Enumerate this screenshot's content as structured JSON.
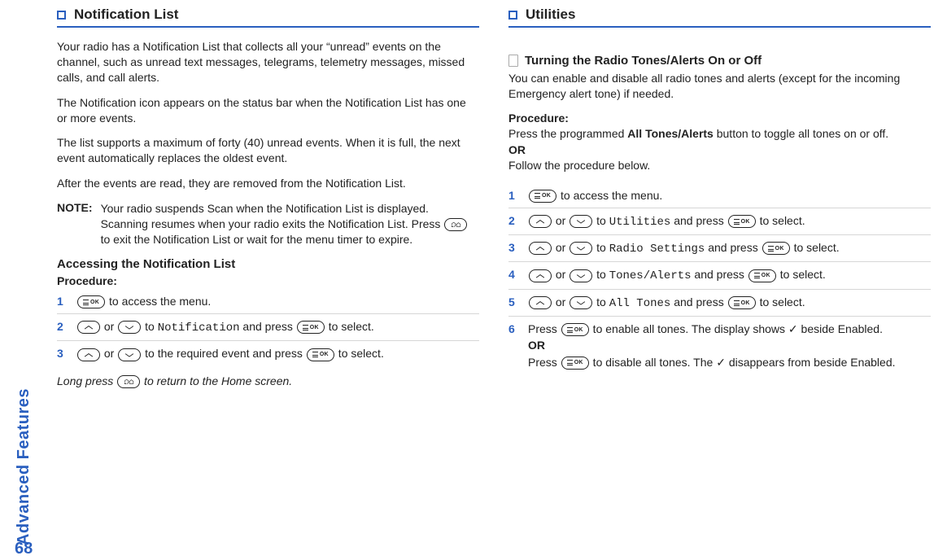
{
  "side_tab": "Advanced Features",
  "page_number": "68",
  "left": {
    "section_title": "Notification List",
    "p1": "Your radio has a Notification List that collects all your “unread” events on the channel, such as unread text messages, telegrams, telemetry messages, missed calls, and call alerts.",
    "p2": "The Notification icon appears on the status bar when the Notification List has one or more events.",
    "p3": " The list supports a maximum of forty (40) unread events. When it is full, the next event automatically replaces the oldest event.",
    "p4": "After the events are read, they are removed from the Notification List.",
    "note_label": "NOTE:",
    "note_body_a": "Your radio suspends Scan when the Notification List is displayed. Scanning resumes when your radio exits the Notification List. Press ",
    "note_body_b": " to exit the Notification List or wait for the menu timer to expire.",
    "sub_heading": "Accessing the Notification List",
    "procedure_label": "Procedure:",
    "steps": {
      "s1_num": "1",
      "s1_b": " to access the menu.",
      "s2_num": "2",
      "s2_or": " or ",
      "s2_to": " to ",
      "s2_target": "Notification",
      "s2_press": " and press ",
      "s2_end": " to select.",
      "s3_num": "3",
      "s3_or": " or ",
      "s3_mid": " to the required event and press ",
      "s3_end": " to select."
    },
    "footer_a": "Long press ",
    "footer_b": " to return to the Home screen."
  },
  "right": {
    "section_title": "Utilities",
    "sub_heading": "Turning the Radio Tones/Alerts On or Off",
    "p1": "You can enable and disable all radio tones and alerts (except for the incoming Emergency alert tone) if needed.",
    "procedure_label": "Procedure:",
    "proc_line_a": "Press the programmed ",
    "proc_bold": "All Tones/Alerts",
    "proc_line_b": " button to toggle all tones on or off.",
    "or_label": "OR",
    "proc_follow": "Follow the procedure below.",
    "steps": {
      "s1_num": "1",
      "s1_b": " to access the menu.",
      "s2_num": "2",
      "s2_or": " or ",
      "s2_to": " to ",
      "s2_target": "Utilities",
      "s2_press": " and press ",
      "s2_end": " to select.",
      "s3_num": "3",
      "s3_or": " or ",
      "s3_to": " to ",
      "s3_target": "Radio Settings",
      "s3_press": " and press ",
      "s3_end": " to select.",
      "s4_num": "4",
      "s4_or": " or ",
      "s4_to": " to ",
      "s4_target": "Tones/Alerts",
      "s4_press": " and press ",
      "s4_end": " to select.",
      "s5_num": "5",
      "s5_or": " or ",
      "s5_to": " to ",
      "s5_target": "All Tones",
      "s5_press": " and press ",
      "s5_end": " to select.",
      "s6_num": "6",
      "s6_a": "Press ",
      "s6_b": " to enable all tones. The display shows ",
      "s6_check1": "✓",
      "s6_c": " beside Enabled.",
      "s6_or": "OR",
      "s6_d": "Press ",
      "s6_e": " to disable all tones. The ",
      "s6_check2": "✓",
      "s6_f": " disappears from beside Enabled."
    }
  }
}
